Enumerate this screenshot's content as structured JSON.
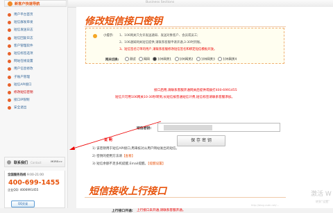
{
  "sidebar": {
    "nav_title": "新客户快速导航",
    "items": [
      {
        "label": "用户平台首页",
        "highlight": false
      },
      {
        "label": "短信群发单发",
        "highlight": false
      },
      {
        "label": "短信发送日志",
        "highlight": false
      },
      {
        "label": "短信回复日志",
        "highlight": false
      },
      {
        "label": "客户管理软件",
        "highlight": false
      },
      {
        "label": "短信标签选项",
        "highlight": false
      },
      {
        "label": "网站在线设置",
        "highlight": false
      },
      {
        "label": "用户信息修改",
        "highlight": false
      },
      {
        "label": "子账户管理",
        "highlight": false
      },
      {
        "label": "短信API接口",
        "highlight": false
      },
      {
        "label": "修改短信密钥",
        "highlight": true
      },
      {
        "label": "接口IP限制",
        "highlight": false
      },
      {
        "label": "安全退出",
        "highlight": false
      }
    ],
    "contact": {
      "title": "联系我们",
      "subtitle": "Contact",
      "more": "MORE>>"
    },
    "hours_label": "全国服务热线",
    "hours_value": "9:00-21:00",
    "phone": "400-699-1455",
    "qq": "企业QQ: 4006991455",
    "qq_button": "QQ交谈"
  },
  "header": {
    "subtitle": "Business Sections"
  },
  "main": {
    "title": "修改短信接口密钥",
    "tip_label": "小提示:",
    "tips": [
      "1、106网关只允许发送通知、发送对象客户、会员或员工;",
      "2、106通知网关短信提供,请联系客服申请开通,3-30时到账。",
      "3、短信签名订单的用户,请联系客服修改短信签名和绑定短信模板开放。"
    ],
    "gateway_label": "网关切换:",
    "gateway_options": [
      "测试",
      "网网",
      "106网关1",
      "106网关2",
      "106网关3",
      "106网关4"
    ],
    "gateway_selected": 2,
    "notice_line1": "接口启用,请联系客服开通网关后提供或拨打400-6991455",
    "notice_line2": "短信只可用106网关10-30秒转到,长短信按普通短信计费,短信标签请联系客服添加。",
    "field_label": "短信密钥:",
    "save_button": "保 存 密 钥",
    "notes_title": "说 明",
    "notes": [
      {
        "text": "1) 该密钥用于短信API接口,用来核对从用户网站发出的短信。",
        "link": ""
      },
      {
        "text": "2) 密钥的使用方法请",
        "link": "【查看】"
      },
      {
        "text": "3) 短信余额不足多机提醒,Email提醒。",
        "link": "【提醒设置】"
      }
    ],
    "section2_title": "短信接收上行接口",
    "uplink_label": "上行接口开通:",
    "uplink_value": "上行接口未开通,请联系客服开通。"
  },
  "watermark": {
    "big": "激活 W",
    "small": "转到“设置”",
    "url": "http://blog.csdn.net/..."
  }
}
